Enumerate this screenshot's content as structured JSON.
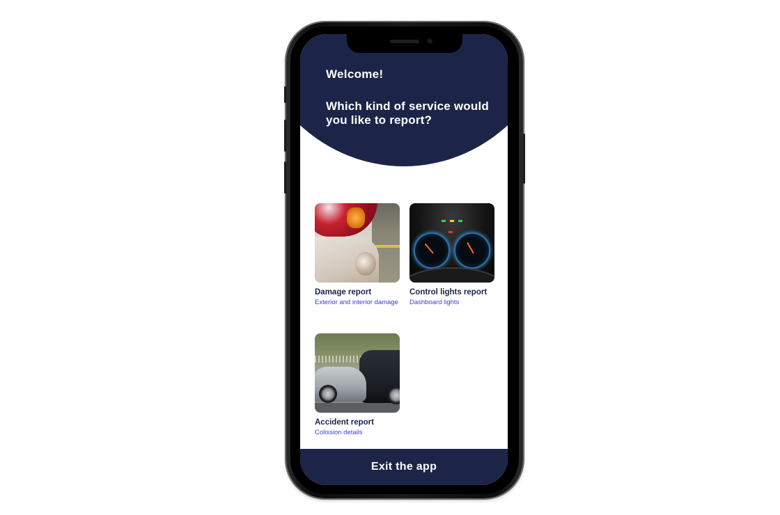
{
  "header": {
    "welcome": "Welcome!",
    "question": "Which kind of service would you like to report?"
  },
  "services": [
    {
      "title": "Damage report",
      "subtitle": "Exterior and interior damage",
      "image": "car-damage-photo"
    },
    {
      "title": "Control lights report",
      "subtitle": "Dashboard lights",
      "image": "dashboard-photo"
    },
    {
      "title": "Accident report",
      "subtitle": "Colission details",
      "image": "car-accident-photo"
    }
  ],
  "footer": {
    "exit_label": "Exit the app"
  },
  "colors": {
    "primary": "#1c2548",
    "accent": "#3b3bd6",
    "background": "#ffffff"
  }
}
